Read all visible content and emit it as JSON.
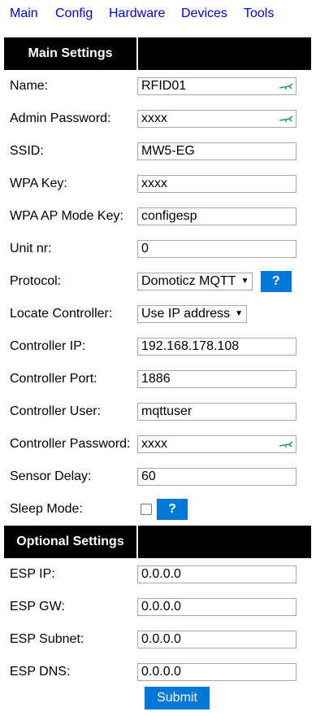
{
  "nav": [
    "Main",
    "Config",
    "Hardware",
    "Devices",
    "Tools"
  ],
  "sections": {
    "main": "Main Settings",
    "optional": "Optional Settings"
  },
  "fields": {
    "name": {
      "label": "Name:",
      "value": "RFID01"
    },
    "admin_password": {
      "label": "Admin Password:",
      "value": "xxxx"
    },
    "ssid": {
      "label": "SSID:",
      "value": "MW5-EG"
    },
    "wpa_key": {
      "label": "WPA Key:",
      "value": "xxxx"
    },
    "wpa_ap_key": {
      "label": "WPA AP Mode Key:",
      "value": "configesp"
    },
    "unit_nr": {
      "label": "Unit nr:",
      "value": "0"
    },
    "protocol": {
      "label": "Protocol:",
      "value": "Domoticz MQTT",
      "help": "?"
    },
    "locate_controller": {
      "label": "Locate Controller:",
      "value": "Use IP address"
    },
    "controller_ip": {
      "label": "Controller IP:",
      "value": "192.168.178.108"
    },
    "controller_port": {
      "label": "Controller Port:",
      "value": "1886"
    },
    "controller_user": {
      "label": "Controller User:",
      "value": "mqttuser"
    },
    "controller_password": {
      "label": "Controller Password:",
      "value": "xxxx"
    },
    "sensor_delay": {
      "label": "Sensor Delay:",
      "value": "60"
    },
    "sleep_mode": {
      "label": "Sleep Mode:",
      "checked": false,
      "help": "?"
    },
    "esp_ip": {
      "label": "ESP IP:",
      "value": "0.0.0.0"
    },
    "esp_gw": {
      "label": "ESP GW:",
      "value": "0.0.0.0"
    },
    "esp_subnet": {
      "label": "ESP Subnet:",
      "value": "0.0.0.0"
    },
    "esp_dns": {
      "label": "ESP DNS:",
      "value": "0.0.0.0"
    }
  },
  "submit_label": "Submit",
  "colors": {
    "accent": "#0078d7",
    "link": "#0000ee",
    "header_bg": "#000000"
  },
  "icons": {
    "password_field": "key-icon"
  }
}
